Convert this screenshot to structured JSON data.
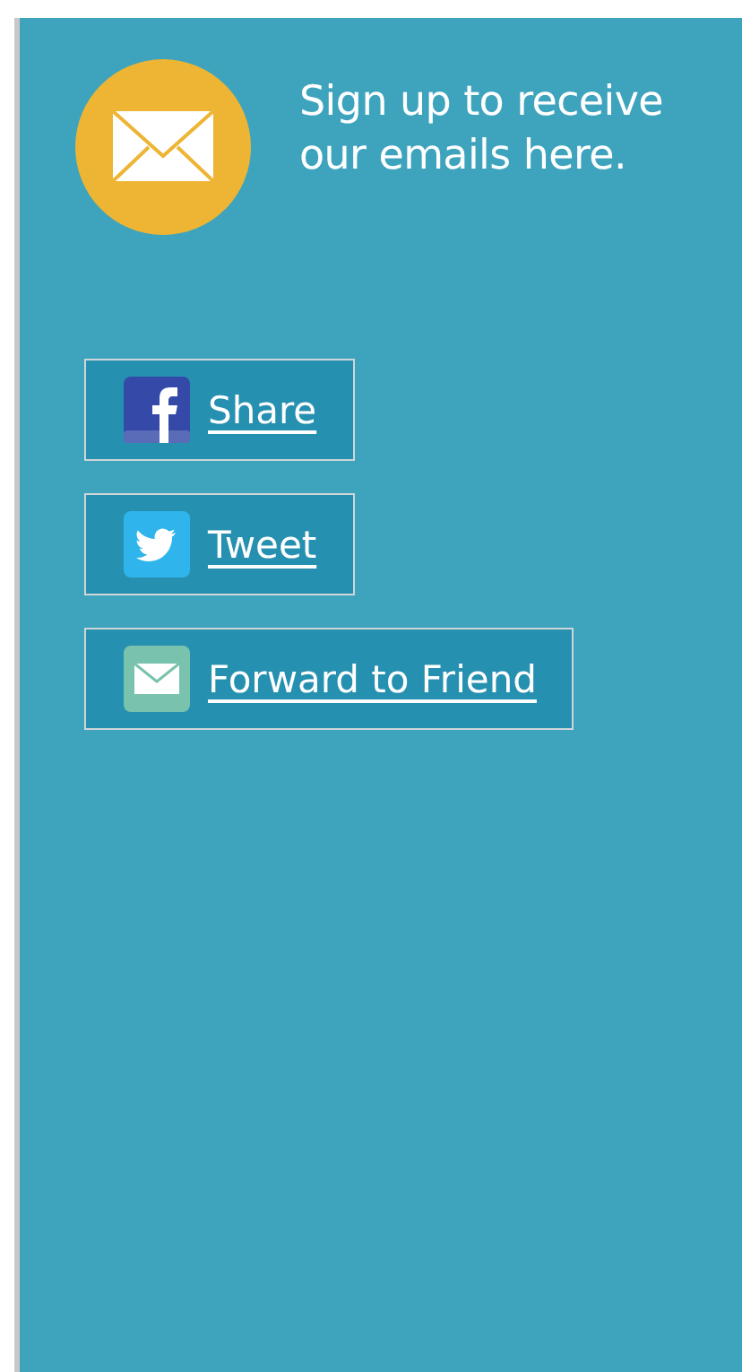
{
  "banner": {
    "text": "Sign up to receive our emails here."
  },
  "share_buttons": [
    {
      "kind": "facebook",
      "label": "Share"
    },
    {
      "kind": "twitter",
      "label": "Tweet"
    },
    {
      "kind": "email",
      "label": "Forward to Friend"
    }
  ]
}
